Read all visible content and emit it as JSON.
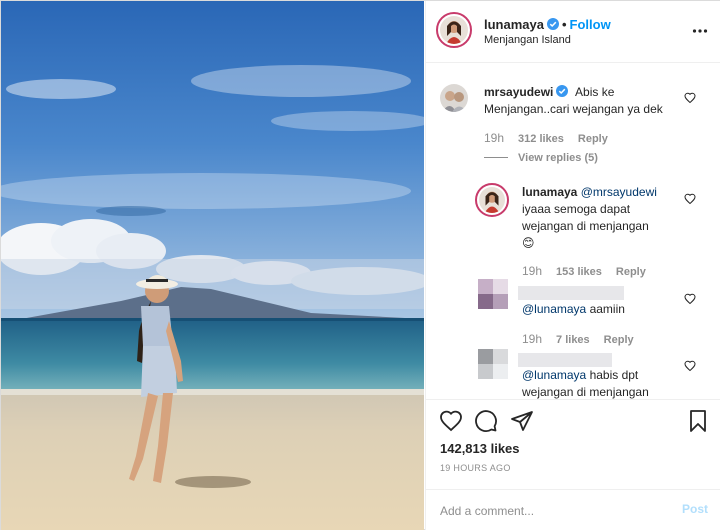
{
  "header": {
    "username": "lunamaya",
    "separator": "•",
    "follow_label": "Follow",
    "location": "Menjangan Island",
    "more_icon": "more-options-icon"
  },
  "comments": [
    {
      "username": "mrsayudewi",
      "text": "Abis ke Menjangan..cari wejangan ya dek",
      "time": "19h",
      "likes": "312 likes",
      "reply_label": "Reply",
      "view_replies": "View replies (5)"
    },
    {
      "username": "lunamaya",
      "mention": "@mrsayudewi",
      "text": "iyaaa semoga dapat wejangan di menjangan",
      "emoji": "😊",
      "time": "19h",
      "likes": "153 likes",
      "reply_label": "Reply"
    },
    {
      "mention": "@lunamaya",
      "text": "aamiin",
      "time": "19h",
      "likes": "7 likes",
      "reply_label": "Reply"
    },
    {
      "mention": "@lunamaya",
      "text": "habis dpt wejangan di menjangan"
    }
  ],
  "actions": {
    "likes": "142,813 likes",
    "timestamp": "19 HOURS AGO"
  },
  "add_comment": {
    "placeholder": "Add a comment...",
    "post_label": "Post"
  },
  "colors": {
    "accent": "#0095f6",
    "text": "#262626",
    "muted": "#8e8e8e",
    "mention": "#00376b"
  }
}
